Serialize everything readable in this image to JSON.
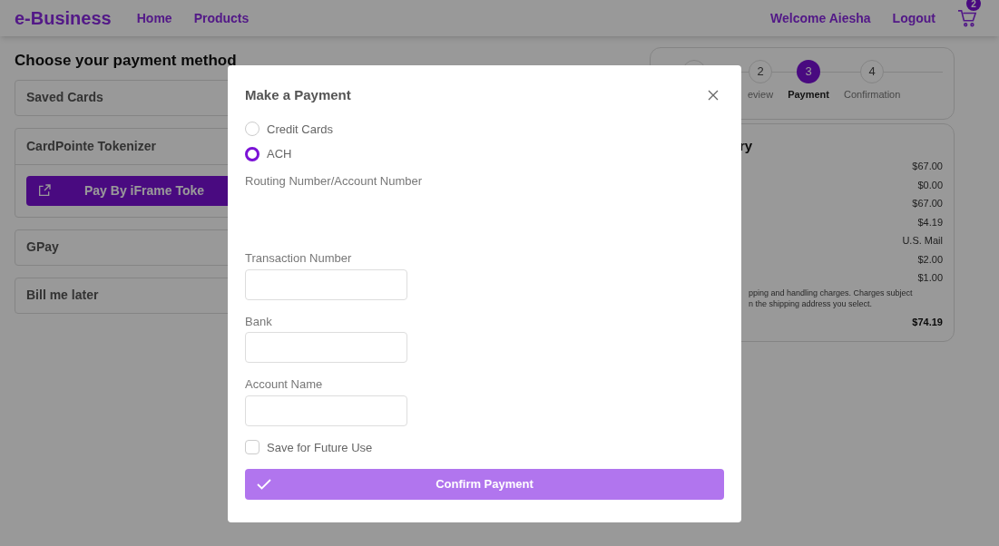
{
  "header": {
    "brand": "e-Business",
    "nav": [
      "Home",
      "Products"
    ],
    "welcome": "Welcome Aiesha",
    "logout": "Logout",
    "cart_count": "2"
  },
  "payment_methods": {
    "title": "Choose your payment method",
    "items": [
      {
        "kind": "plain",
        "label": "Saved Cards"
      },
      {
        "kind": "tokenizer",
        "label": "CardPointe Tokenizer",
        "button": "Pay By iFrame Toke"
      },
      {
        "kind": "plain",
        "label": "GPay"
      },
      {
        "kind": "plain",
        "label": "Bill me later"
      }
    ]
  },
  "stepper": {
    "steps": [
      {
        "number": "2",
        "label": "eview",
        "selected": false
      },
      {
        "number": "3",
        "label": "Payment",
        "selected": true
      },
      {
        "number": "4",
        "label": "Confirmation",
        "selected": false
      }
    ]
  },
  "summary": {
    "heading": "ry",
    "values": [
      "$67.00",
      "$0.00",
      "$67.00",
      "$4.19",
      "U.S. Mail",
      "$2.00",
      "$1.00"
    ],
    "note": [
      "pping and handling charges. Charges subject",
      "n the shipping address you select."
    ],
    "total": "$74.19"
  },
  "modal": {
    "title": "Make a Payment",
    "options": [
      {
        "label": "Credit Cards",
        "selected": false
      },
      {
        "label": "ACH",
        "selected": true
      }
    ],
    "routing_label": "Routing Number/Account Number",
    "fields": [
      {
        "label": "Transaction Number"
      },
      {
        "label": "Bank"
      },
      {
        "label": "Account Name"
      }
    ],
    "save": {
      "label": "Save for Future Use",
      "checked": false
    },
    "confirm_button": "Confirm Payment"
  }
}
